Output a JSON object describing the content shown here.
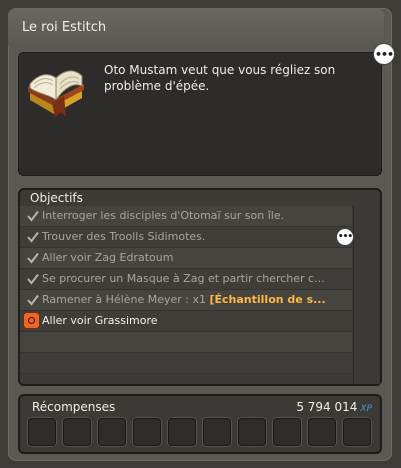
{
  "window": {
    "title": "Le roi Estitch"
  },
  "quest": {
    "description": "Oto Mustam veut que vous régliez son problème d'épée.",
    "icon": "open-book-icon",
    "chat_icon": "ellipsis-bubble-icon"
  },
  "objectives": {
    "header": "Objectifs",
    "items": [
      {
        "text": "Interroger les disciples d'Otomaï sur son île.",
        "done": true
      },
      {
        "text": "Trouver des Troolls Sidimotes.",
        "done": true,
        "has_bubble": true
      },
      {
        "text": "Aller voir Zag Edratoum",
        "done": true
      },
      {
        "text": "Se procurer un Masque à Zag et partir chercher c...",
        "done": true
      },
      {
        "text": "Ramener à Hélène Meyer : x1 ",
        "highlight": "[Échantillon de s...",
        "done": true
      },
      {
        "text": "Aller voir Grassimore",
        "done": false,
        "current": true
      }
    ]
  },
  "rewards": {
    "label": "Récompenses",
    "xp_value": "5 794 014",
    "xp_unit": "XP",
    "slot_count": 10
  },
  "colors": {
    "highlight": "#ffb844",
    "xp_accent": "#4f8fd0",
    "current_marker": "#e8672a"
  }
}
